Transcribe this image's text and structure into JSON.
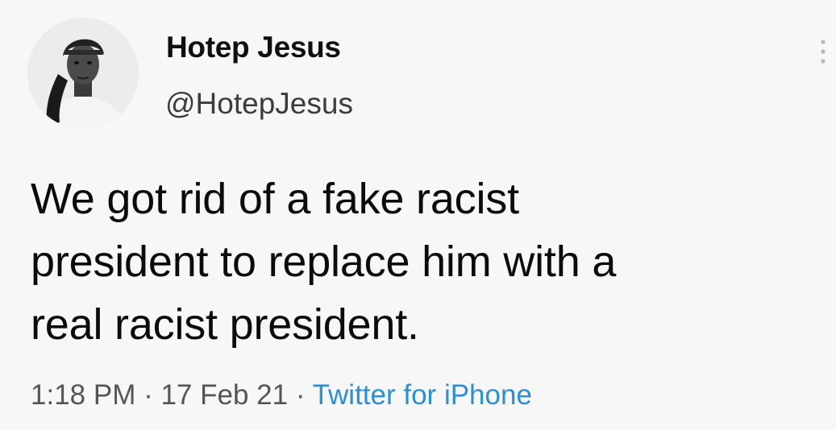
{
  "user": {
    "display_name": "Hotep Jesus",
    "handle": "@HotepJesus",
    "avatar_icon": "profile-photo"
  },
  "more_icon": "more-options-icon",
  "tweet": {
    "lines": [
      "We got rid of a fake racist",
      "president to replace him with a",
      "real racist president."
    ]
  },
  "meta": {
    "time": "1:18 PM",
    "separator": " · ",
    "date": "17 Feb 21",
    "source": "Twitter for iPhone"
  },
  "colors": {
    "background": "#f7f7f7",
    "link": "#2a8fd9",
    "text": "#0b0b0b"
  }
}
